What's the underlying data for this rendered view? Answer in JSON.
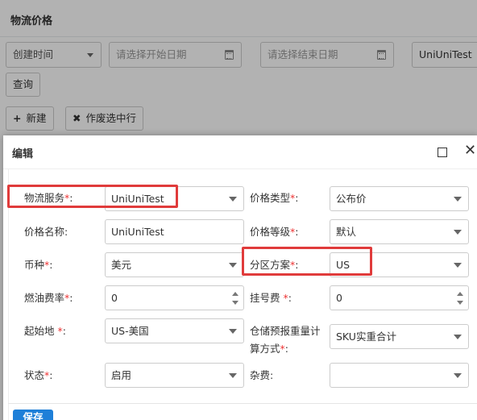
{
  "background": {
    "page_title": "物流价格",
    "filter": {
      "time_type": "创建时间",
      "start_date_placeholder": "请选择开始日期",
      "end_date_placeholder": "请选择结束日期",
      "service_value": "UniUniTest"
    },
    "query_label": "查询",
    "new_label": "新建",
    "void_label": "作废选中行"
  },
  "modal": {
    "title": "编辑",
    "fields": {
      "service": {
        "label": "物流服务",
        "value": "UniUniTest"
      },
      "price_type": {
        "label": "价格类型",
        "value": "公布价"
      },
      "price_name": {
        "label": "价格名称:",
        "value": "UniUniTest"
      },
      "price_level": {
        "label": "价格等级",
        "value": "默认"
      },
      "currency": {
        "label": "币种",
        "value": "美元"
      },
      "zone_plan": {
        "label": "分区方案",
        "value": "US"
      },
      "fuel_rate": {
        "label": "燃油费率",
        "value": "0"
      },
      "reg_fee": {
        "label": "挂号费 ",
        "value": "0"
      },
      "origin": {
        "label": "起始地 ",
        "value": "US-美国"
      },
      "weight_method": {
        "label_line1": "仓储预报重量计",
        "label_line2": "算方式",
        "value": "SKU实重合计"
      },
      "status": {
        "label": "状态",
        "value": "启用"
      },
      "misc_fee": {
        "label": "杂费:",
        "value": ""
      }
    },
    "save_label": "保存"
  },
  "req_mark": "*",
  "colon": ":",
  "colors": {
    "required": "#e33333",
    "highlight": "#e03b3b",
    "primary": "#1e7fd8"
  }
}
